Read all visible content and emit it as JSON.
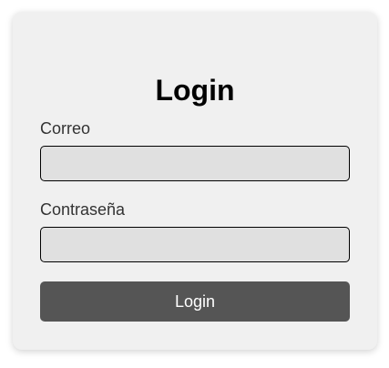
{
  "form": {
    "title": "Login",
    "email_label": "Correo",
    "email_value": "",
    "password_label": "Contraseña",
    "password_value": "",
    "submit_label": "Login"
  }
}
